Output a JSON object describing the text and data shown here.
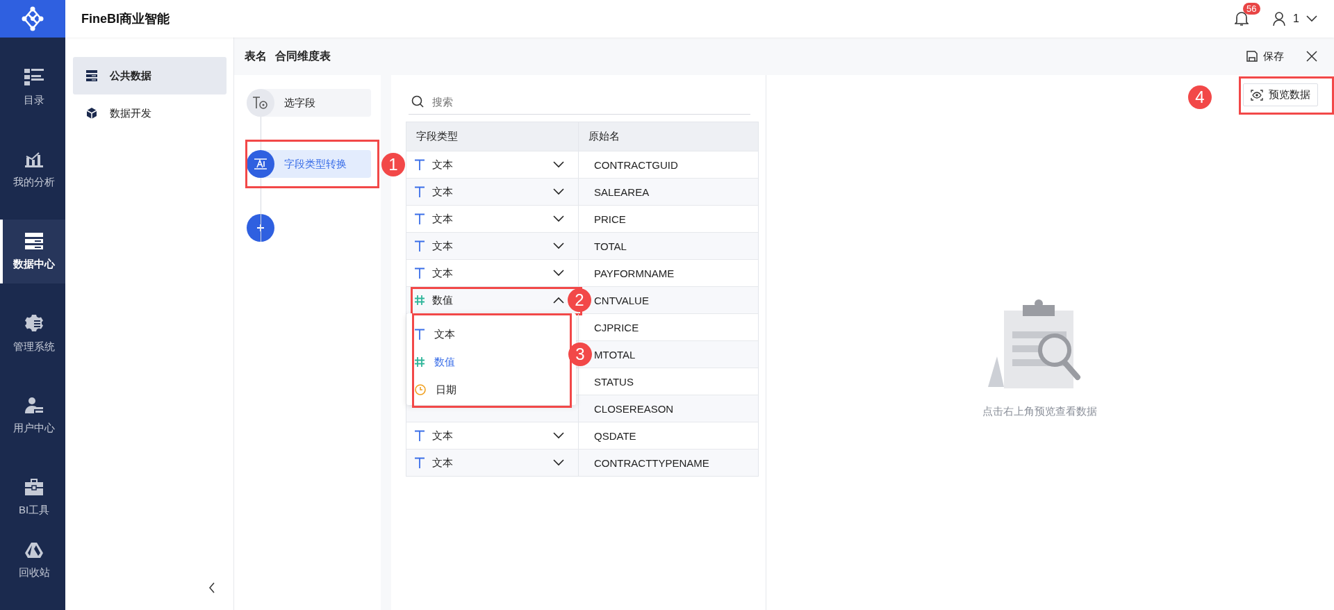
{
  "brand": {
    "title": "FineBI商业智能"
  },
  "nav": [
    {
      "label": "目录",
      "selected": false
    },
    {
      "label": "我的分析",
      "selected": false
    },
    {
      "label": "数据中心",
      "selected": true
    },
    {
      "label": "管理系统",
      "selected": false
    },
    {
      "label": "用户中心",
      "selected": false
    },
    {
      "label": "BI工具",
      "selected": false
    },
    {
      "label": "回收站",
      "selected": false
    }
  ],
  "header": {
    "notifications": "56",
    "user": "1"
  },
  "subnav": [
    {
      "label": "公共数据",
      "selected": true
    },
    {
      "label": "数据开发",
      "selected": false
    }
  ],
  "editor": {
    "table_label": "表名",
    "table_name": "合同维度表",
    "save": "保存"
  },
  "steps": [
    {
      "label": "选字段",
      "selected": false
    },
    {
      "label": "字段类型转换",
      "selected": true
    }
  ],
  "search": {
    "placeholder": "搜索"
  },
  "table": {
    "columns": [
      "字段类型",
      "原始名"
    ],
    "rows": [
      {
        "type": {
          "kind": "text",
          "label": "文本"
        },
        "open": false,
        "name": "CONTRACTGUID"
      },
      {
        "type": {
          "kind": "text",
          "label": "文本"
        },
        "open": false,
        "name": "SALEAREA"
      },
      {
        "type": {
          "kind": "text",
          "label": "文本"
        },
        "open": false,
        "name": "PRICE"
      },
      {
        "type": {
          "kind": "text",
          "label": "文本"
        },
        "open": false,
        "name": "TOTAL"
      },
      {
        "type": {
          "kind": "text",
          "label": "文本"
        },
        "open": false,
        "name": "PAYFORMNAME"
      },
      {
        "type": {
          "kind": "number",
          "label": "数值"
        },
        "open": true,
        "name": "CNTVALUE"
      },
      {
        "name": "CJPRICE"
      },
      {
        "name": "MTOTAL"
      },
      {
        "name": "STATUS"
      },
      {
        "name": "CLOSEREASON"
      },
      {
        "type": {
          "kind": "text",
          "label": "文本"
        },
        "open": false,
        "name": "QSDATE"
      },
      {
        "type": {
          "kind": "text",
          "label": "文本"
        },
        "open": false,
        "name": "CONTRACTTYPENAME"
      }
    ]
  },
  "dropdown": [
    {
      "kind": "text",
      "label": "文本",
      "selected": false
    },
    {
      "kind": "number",
      "label": "数值",
      "selected": true
    },
    {
      "kind": "date",
      "label": "日期",
      "selected": false
    }
  ],
  "preview": {
    "button": "预览数据",
    "empty_text": "点击右上角预览查看数据"
  },
  "callouts": [
    "1",
    "2",
    "3",
    "4"
  ]
}
